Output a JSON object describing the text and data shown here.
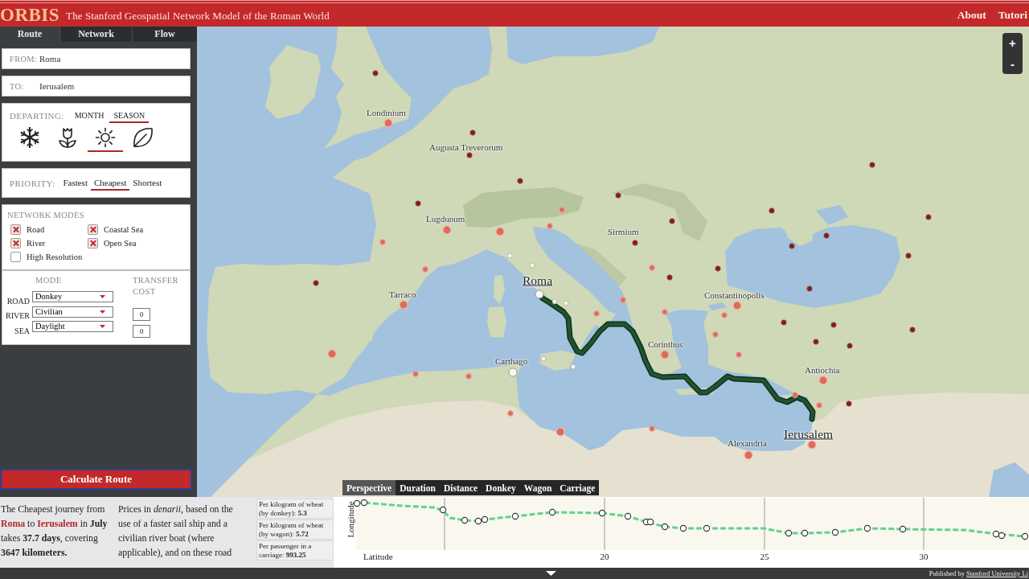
{
  "header": {
    "logo": "ORBIS",
    "subtitle": "The Stanford Geospatial Network Model of the Roman World",
    "links": [
      "About",
      "Tutori"
    ]
  },
  "sidebar": {
    "tabs": [
      {
        "label": "Route",
        "selected": true
      },
      {
        "label": "Network",
        "selected": false
      },
      {
        "label": "Flow",
        "selected": false
      }
    ],
    "from": {
      "label": "FROM:",
      "value": "Roma"
    },
    "to": {
      "label": "TO:",
      "value": "Ierusalem"
    },
    "departing": {
      "label": "DEPARTING:",
      "options": [
        {
          "label": "MONTH",
          "selected": false
        },
        {
          "label": "SEASON",
          "selected": true
        }
      ],
      "seasons": [
        {
          "kind": "winter",
          "selected": false
        },
        {
          "kind": "spring",
          "selected": false
        },
        {
          "kind": "summer",
          "selected": true
        },
        {
          "kind": "autumn",
          "selected": false
        }
      ]
    },
    "priority": {
      "label": "PRIORITY:",
      "options": [
        {
          "label": "Fastest",
          "selected": false
        },
        {
          "label": "Cheapest",
          "selected": true
        },
        {
          "label": "Shortest",
          "selected": false
        }
      ]
    },
    "network_modes": {
      "title": "NETWORK MODES",
      "items": [
        {
          "label": "Road",
          "checked": true
        },
        {
          "label": "Coastal Sea",
          "checked": true
        },
        {
          "label": "River",
          "checked": true
        },
        {
          "label": "Open Sea",
          "checked": true
        },
        {
          "label": "High Resolution",
          "checked": false
        }
      ]
    },
    "modes": {
      "mode_heading": "MODE",
      "cost_heading": "TRANSFER COST",
      "rows": [
        {
          "label": "ROAD",
          "value": "Donkey"
        },
        {
          "label": "RIVER",
          "value": "Civilian",
          "cost": "0"
        },
        {
          "label": "SEA",
          "value": "Daylight",
          "cost": "0"
        }
      ]
    },
    "calculate_button": "Calculate Route"
  },
  "map": {
    "zoom_controls": [
      "+",
      "-"
    ],
    "cities": [
      {
        "name": "Londinium",
        "kind": "city"
      },
      {
        "name": "Augusta Treverorum",
        "kind": "city"
      },
      {
        "name": "Lugdunum",
        "kind": "city"
      },
      {
        "name": "Sirmium",
        "kind": "city"
      },
      {
        "name": "Roma",
        "kind": "endpoint"
      },
      {
        "name": "Tarraco",
        "kind": "city"
      },
      {
        "name": "Constantinopolis",
        "kind": "city"
      },
      {
        "name": "Corinthus",
        "kind": "city"
      },
      {
        "name": "Carthago",
        "kind": "city"
      },
      {
        "name": "Antiochia",
        "kind": "city"
      },
      {
        "name": "Ierusalem",
        "kind": "endpoint"
      },
      {
        "name": "Alexandria",
        "kind": "city"
      }
    ]
  },
  "summary": {
    "journey": "The Cheapest journey from **Roma** to **Ierusalem** in **July** takes **37.7 days**, covering **3647 kilometers.**",
    "prices_note": "Prices in *denarii*, based on the use of a faster sail ship and a civilian river boat (where applicable), and on these road",
    "prices": [
      "Per kilogram of wheat (by donkey): **5.3**",
      "Per kilogram of wheat (by wagon): **5.72**",
      "Per passenger in a carriage: **993.25**"
    ]
  },
  "chart": {
    "tabs": [
      {
        "label": "Perspective",
        "selected": true
      },
      {
        "label": "Duration",
        "selected": false
      },
      {
        "label": "Distance",
        "selected": false
      },
      {
        "label": "Donkey",
        "selected": false
      },
      {
        "label": "Wagon",
        "selected": false
      },
      {
        "label": "Carriage",
        "selected": false
      }
    ],
    "ylabel": "Longitude",
    "xlabel": "Latitude",
    "tick_labels": [
      "20",
      "25",
      "30"
    ]
  },
  "footer": {
    "credit": "Published by",
    "link": "Stanford University Li"
  }
}
